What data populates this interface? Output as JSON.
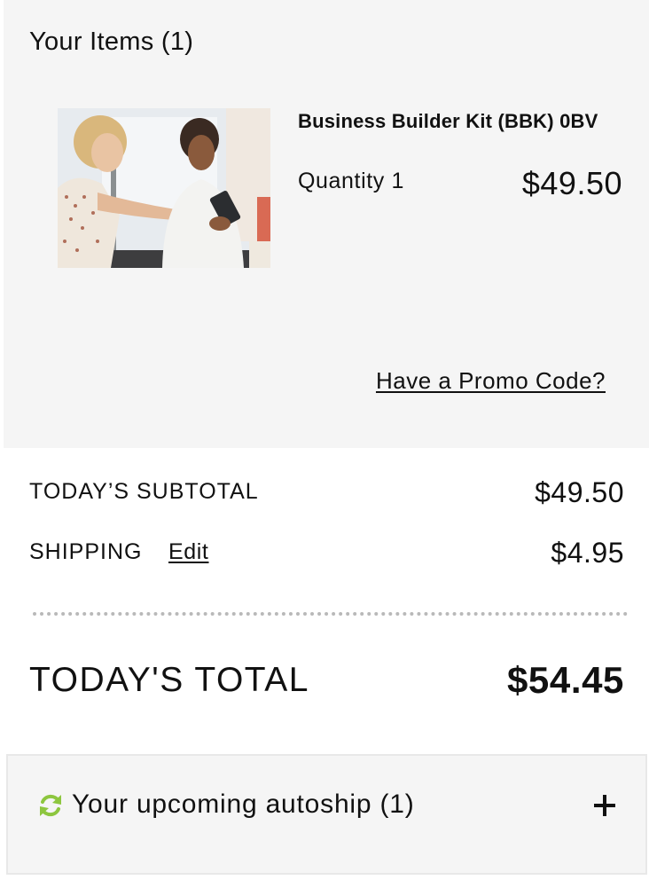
{
  "cart": {
    "items_title": "Your Items (1)",
    "items": [
      {
        "name": "Business Builder Kit (BBK) 0BV",
        "quantity_label": "Quantity 1",
        "price": "$49.50",
        "image": "two-women-with-tablet-photo"
      }
    ],
    "promo_link": "Have a Promo Code?"
  },
  "summary": {
    "subtotal_label": "TODAY’S SUBTOTAL",
    "subtotal_value": "$49.50",
    "shipping_label": "SHIPPING",
    "shipping_edit": "Edit",
    "shipping_value": "$4.95",
    "total_label": "TODAY'S TOTAL",
    "total_value": "$54.45"
  },
  "autoship": {
    "label": "Your upcoming autoship (1)",
    "icon": "refresh-icon",
    "toggle_icon": "plus-icon",
    "icon_color": "#8dc63f"
  }
}
